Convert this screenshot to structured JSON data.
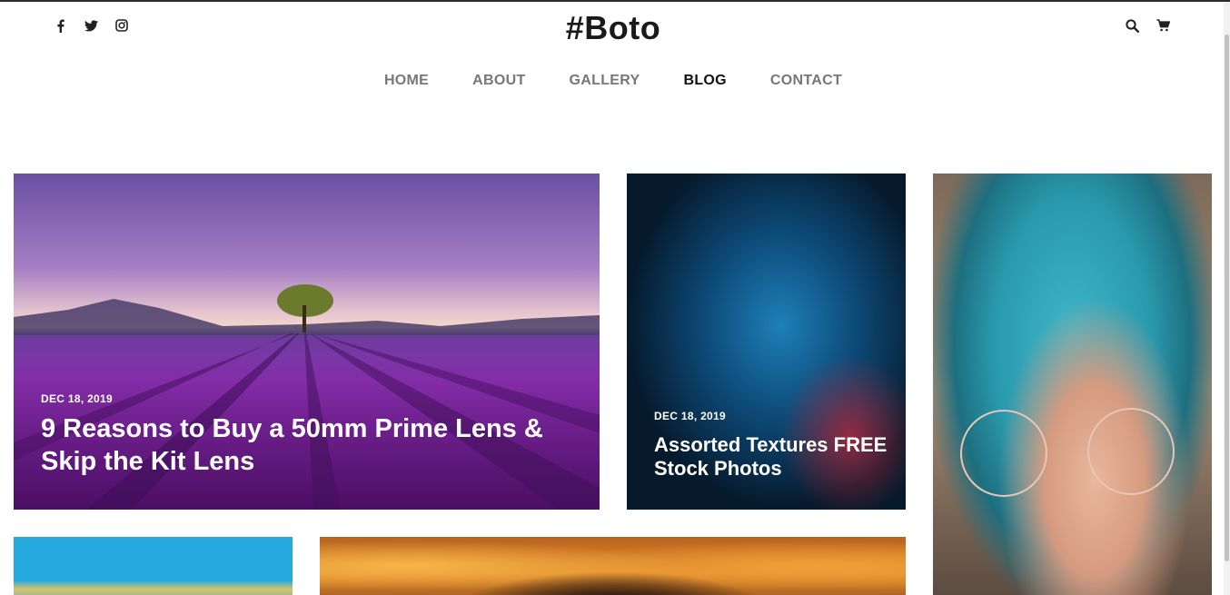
{
  "header": {
    "logo": "#Boto",
    "social_icons": [
      "facebook-icon",
      "twitter-icon",
      "instagram-icon"
    ],
    "tool_icons": [
      "search-icon",
      "cart-icon"
    ]
  },
  "nav": {
    "items": [
      {
        "label": "HOME"
      },
      {
        "label": "ABOUT"
      },
      {
        "label": "GALLERY"
      },
      {
        "label": "BLOG",
        "active": true
      },
      {
        "label": "CONTACT"
      }
    ],
    "active_underline_color": "#88b04b"
  },
  "posts": [
    {
      "date": "DEC 18, 2019",
      "title": "9 Reasons to Buy a 50mm Prime Lens & Skip the Kit Lens"
    },
    {
      "date": "DEC 18, 2019",
      "title": "Assorted Textures FREE Stock Photos"
    }
  ]
}
